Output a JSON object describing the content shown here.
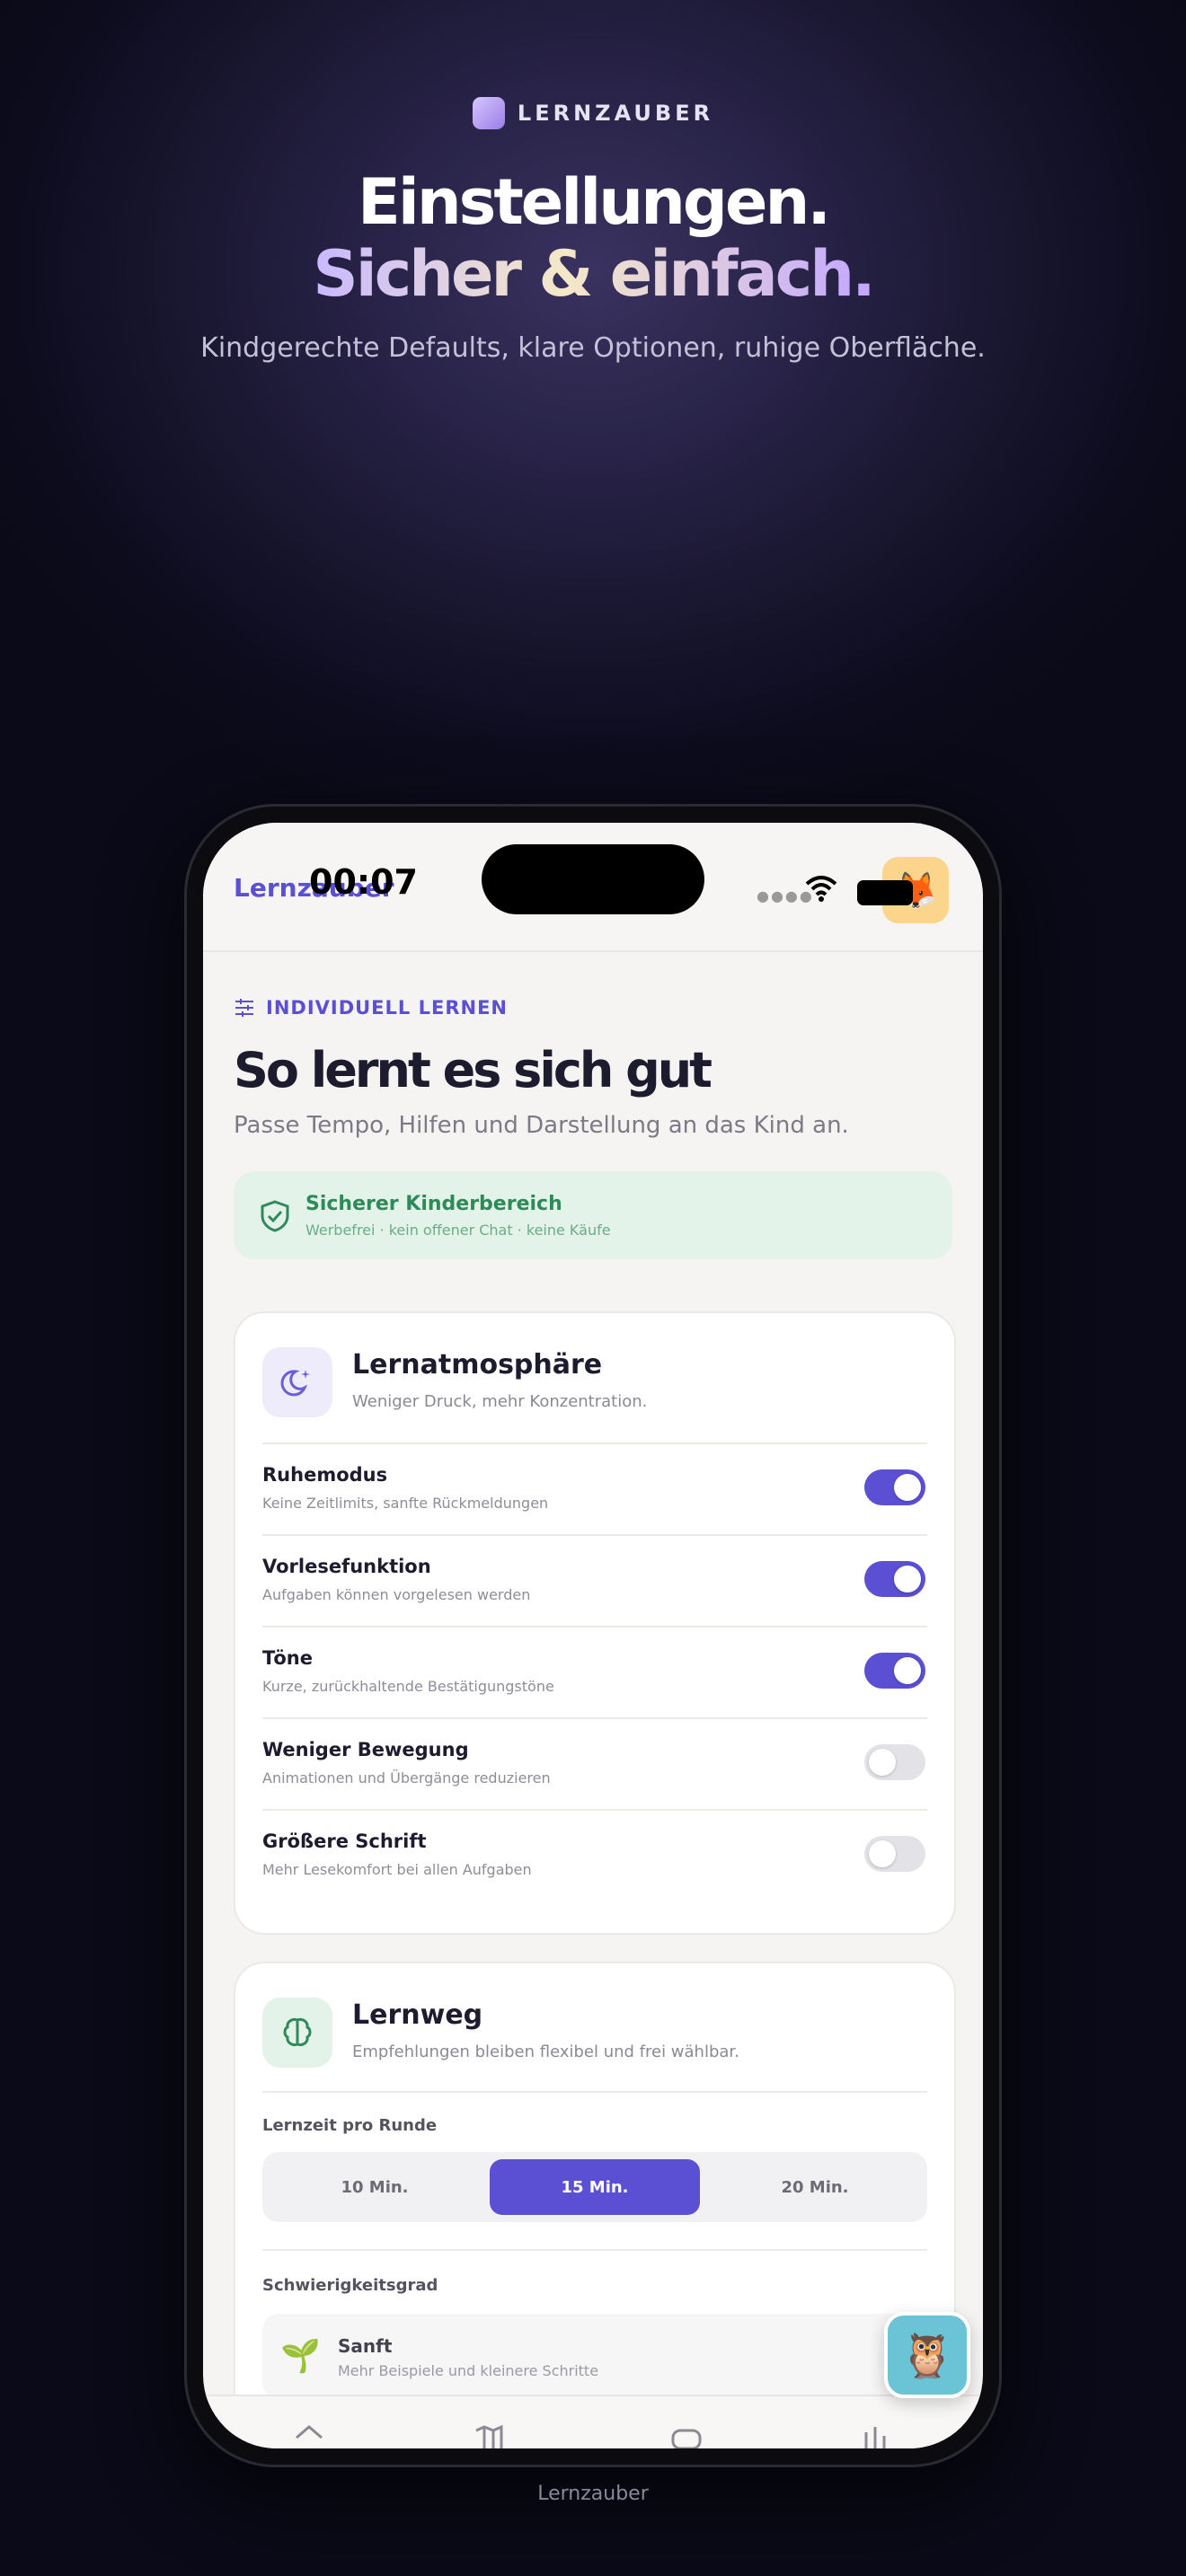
{
  "brand": {
    "name": "LERNZAUBER"
  },
  "hero": {
    "line1": "Einstellungen.",
    "line2": "Sicher & einfach.",
    "subtitle": "Kindgerechte Defaults, klare Optionen, ruhige Oberfläche."
  },
  "status_bar": {
    "time": "00:07"
  },
  "app": {
    "title": "Lernzauber"
  },
  "page": {
    "eyebrow": "INDIVIDUELL LERNEN",
    "title": "So lernt es sich gut",
    "subtitle": "Passe Tempo, Hilfen und Darstellung an das Kind an."
  },
  "safe_banner": {
    "title": "Sicherer Kinderbereich",
    "subtitle": "Werbefrei · kein offener Chat · keine Käufe"
  },
  "atmosphere": {
    "title": "Lernatmosphäre",
    "subtitle": "Weniger Druck, mehr Konzentration.",
    "settings": [
      {
        "label": "Ruhemodus",
        "description": "Keine Zeitlimits, sanfte Rückmeldungen",
        "enabled": true
      },
      {
        "label": "Vorlesefunktion",
        "description": "Aufgaben können vorgelesen werden",
        "enabled": true
      },
      {
        "label": "Töne",
        "description": "Kurze, zurückhaltende Bestätigungstöne",
        "enabled": true
      },
      {
        "label": "Weniger Bewegung",
        "description": "Animationen und Übergänge reduzieren",
        "enabled": false
      },
      {
        "label": "Größere Schrift",
        "description": "Mehr Lesekomfort bei allen Aufgaben",
        "enabled": false
      }
    ]
  },
  "path": {
    "title": "Lernweg",
    "subtitle": "Empfehlungen bleiben flexibel und frei wählbar.",
    "time_label": "Lernzeit pro Runde",
    "time_options": [
      "10 Min.",
      "15 Min.",
      "20 Min."
    ],
    "time_selected": "15 Min.",
    "difficulty_label": "Schwierigkeitsgrad",
    "difficulty_options": [
      {
        "label": "Sanft",
        "description": "Mehr Beispiele und kleinere Schritte"
      }
    ]
  },
  "footer": {
    "caption": "Lernzauber"
  },
  "colors": {
    "accent": "#5b4fd3",
    "safe_green": "#2f8a5a",
    "toggle_off": "#e3e2e6"
  }
}
